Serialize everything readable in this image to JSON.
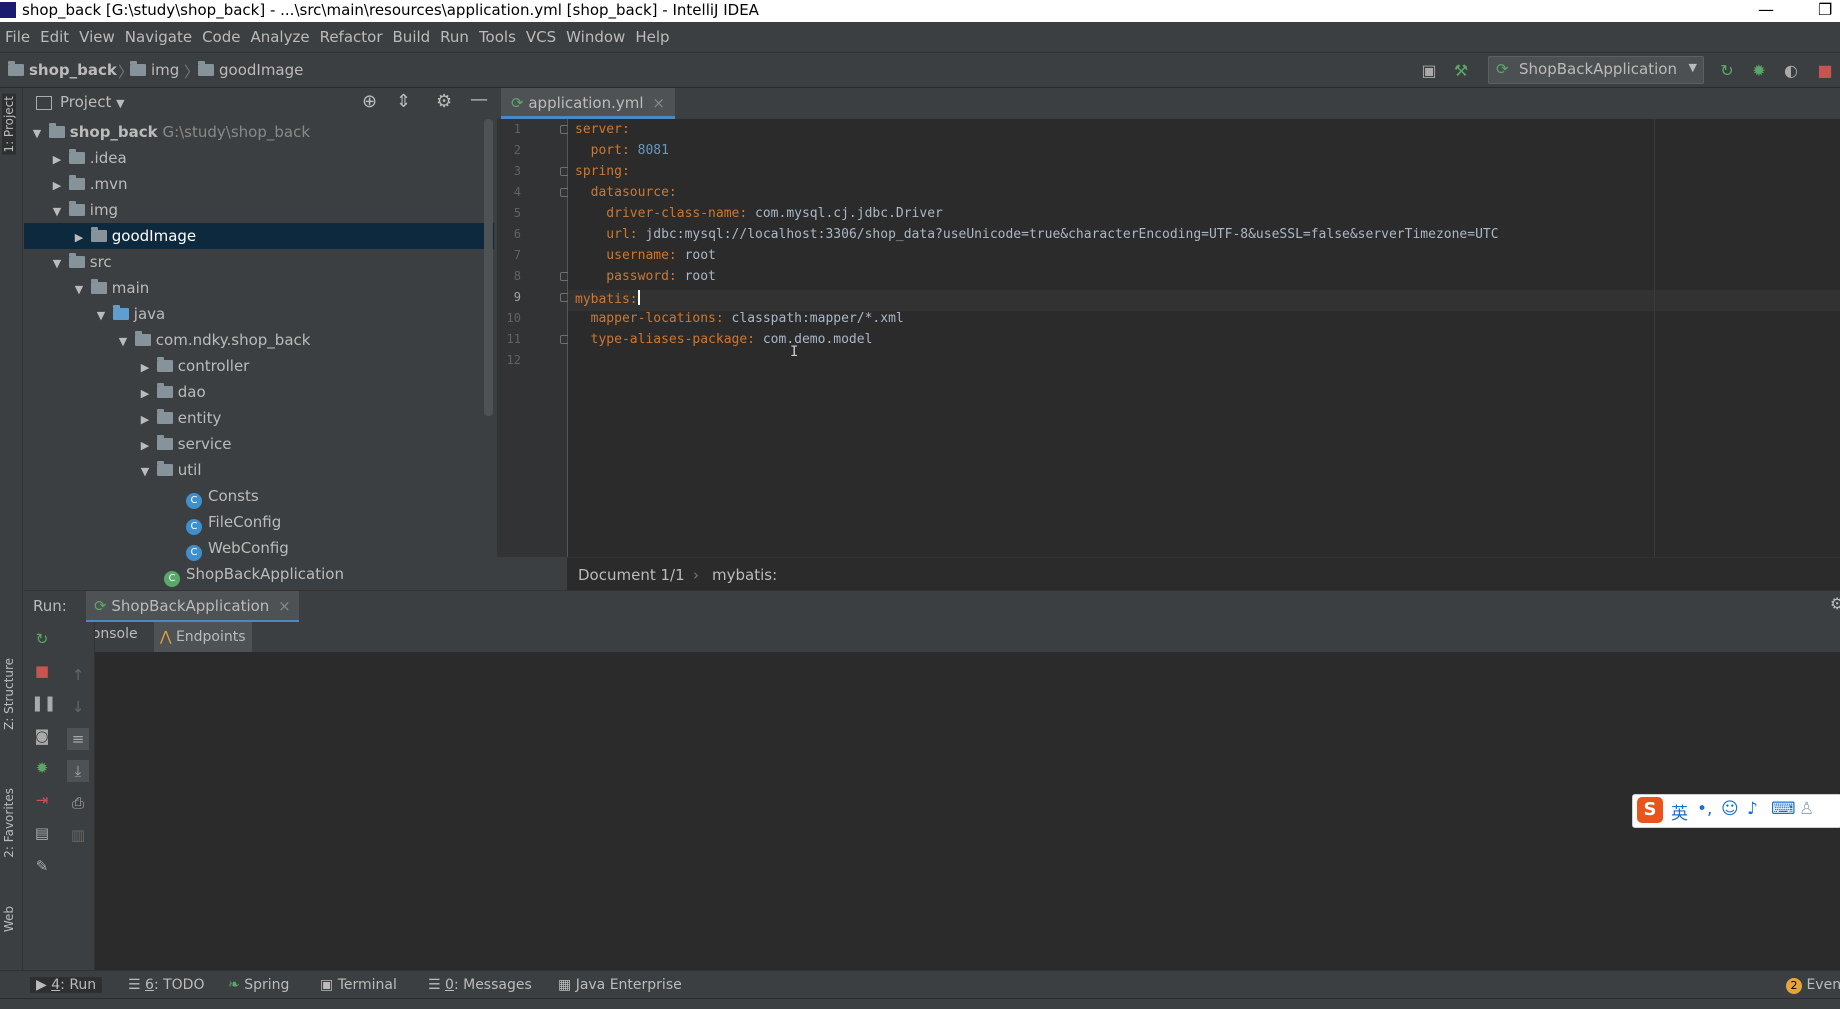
{
  "title_bar": {
    "title": "shop_back [G:\\study\\shop_back] - ...\\src\\main\\resources\\application.yml [shop_back] - IntelliJ IDEA",
    "minimize": "—",
    "restore": "❐"
  },
  "menu": [
    "File",
    "Edit",
    "View",
    "Navigate",
    "Code",
    "Analyze",
    "Refactor",
    "Build",
    "Run",
    "Tools",
    "VCS",
    "Window",
    "Help"
  ],
  "breadcrumb": [
    "shop_back",
    "img",
    "goodImage"
  ],
  "run_config": {
    "label": "ShopBackApplication"
  },
  "left_stripe": {
    "project_tab": "1: Project",
    "structure_tab": "Z: Structure",
    "favorites_tab": "2: Favorites",
    "web_tab": "Web"
  },
  "project_panel": {
    "title": "Project",
    "tree": [
      {
        "label": "shop_back",
        "extra": "G:\\study\\shop_back"
      },
      {
        "label": ".idea"
      },
      {
        "label": ".mvn"
      },
      {
        "label": "img"
      },
      {
        "label": "goodImage",
        "selected": true
      },
      {
        "label": "src"
      },
      {
        "label": "main"
      },
      {
        "label": "java"
      },
      {
        "label": "com.ndky.shop_back"
      },
      {
        "label": "controller"
      },
      {
        "label": "dao"
      },
      {
        "label": "entity"
      },
      {
        "label": "service"
      },
      {
        "label": "util"
      },
      {
        "label": "Consts"
      },
      {
        "label": "FileConfig"
      },
      {
        "label": "WebConfig"
      },
      {
        "label": "ShopBackApplication"
      }
    ]
  },
  "editor": {
    "tab": "application.yml",
    "line_numbers": [
      "1",
      "2",
      "3",
      "4",
      "5",
      "6",
      "7",
      "8",
      "9",
      "10",
      "11",
      "12"
    ],
    "lines": [
      {
        "key": "server:",
        "value": ""
      },
      {
        "key": "  port:",
        "value": " 8081"
      },
      {
        "key": "spring:",
        "value": ""
      },
      {
        "key": "  datasource:",
        "value": ""
      },
      {
        "key": "    driver-class-name:",
        "value": " com.mysql.cj.jdbc.Driver"
      },
      {
        "key": "    url:",
        "value": " jdbc:mysql://localhost:3306/shop_data?useUnicode=true&characterEncoding=UTF-8&useSSL=false&serverTimezone=UTC"
      },
      {
        "key": "    username:",
        "value": " root"
      },
      {
        "key": "    password:",
        "value": " root"
      },
      {
        "key": "mybatis:",
        "value": ""
      },
      {
        "key": "  mapper-locations:",
        "value": " classpath:mapper/*.xml"
      },
      {
        "key": "  type-aliases-package:",
        "value": " com.demo.model"
      },
      {
        "key": "",
        "value": ""
      }
    ],
    "status_doc": "Document 1/1",
    "status_path": "mybatis:"
  },
  "run_window": {
    "label": "Run:",
    "tab": "ShopBackApplication",
    "console_tab": "Console",
    "endpoints_tab": "Endpoints"
  },
  "bottom_tabs": [
    {
      "num": "4",
      "label": "Run"
    },
    {
      "num": "6",
      "label": "TODO"
    },
    {
      "num": "",
      "label": "Spring"
    },
    {
      "num": "",
      "label": "Terminal"
    },
    {
      "num": "0",
      "label": "Messages"
    },
    {
      "num": "",
      "label": "Java Enterprise"
    }
  ],
  "event_log": {
    "count": "2",
    "label": "Even"
  },
  "ime": {
    "lang": "英"
  }
}
